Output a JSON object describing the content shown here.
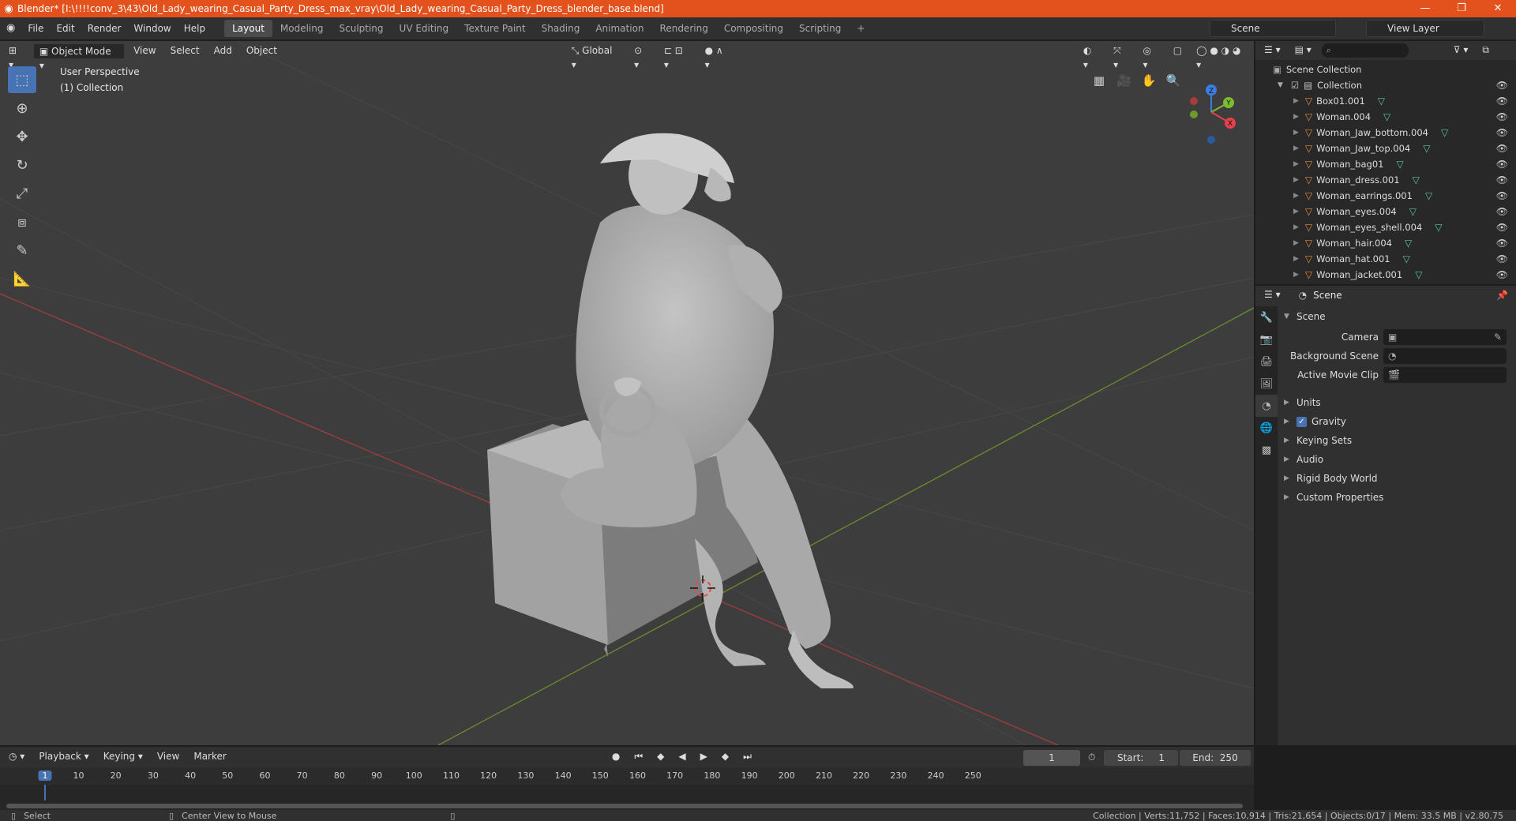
{
  "window": {
    "title": "Blender* [I:\\!!!!conv_3\\43\\Old_Lady_wearing_Casual_Party_Dress_max_vray\\Old_Lady_wearing_Casual_Party_Dress_blender_base.blend]",
    "controls": [
      "—",
      "❐",
      "✕"
    ]
  },
  "menu": [
    "File",
    "Edit",
    "Render",
    "Window",
    "Help"
  ],
  "workspaces": [
    "Layout",
    "Modeling",
    "Sculpting",
    "UV Editing",
    "Texture Paint",
    "Shading",
    "Animation",
    "Rendering",
    "Compositing",
    "Scripting"
  ],
  "workspace_add": "+",
  "active_workspace": "Layout",
  "scene_name": "Scene",
  "view_layer_name": "View Layer",
  "viewport": {
    "mode": "Object Mode",
    "menus": [
      "View",
      "Select",
      "Add",
      "Object"
    ],
    "transform_orientation": "Global",
    "info_line1": "User Perspective",
    "info_line2": "(1) Collection",
    "gizmo": {
      "z": "Z",
      "y": "Y",
      "x": "X"
    }
  },
  "outliner": {
    "root": "Scene Collection",
    "collection": "Collection",
    "objects": [
      "Box01.001",
      "Woman.004",
      "Woman_Jaw_bottom.004",
      "Woman_Jaw_top.004",
      "Woman_bag01",
      "Woman_dress.001",
      "Woman_earrings.001",
      "Woman_eyes.004",
      "Woman_eyes_shell.004",
      "Woman_hair.004",
      "Woman_hat.001",
      "Woman_jacket.001"
    ]
  },
  "properties": {
    "header": "Scene",
    "panel": "Scene",
    "fields": [
      {
        "label": "Camera",
        "value": ""
      },
      {
        "label": "Background Scene",
        "value": ""
      },
      {
        "label": "Active Movie Clip",
        "value": ""
      }
    ],
    "sections": [
      "Units",
      "Gravity",
      "Keying Sets",
      "Audio",
      "Rigid Body World",
      "Custom Properties"
    ],
    "gravity_checked": true
  },
  "timeline": {
    "menus": [
      "Playback",
      "Keying",
      "View",
      "Marker"
    ],
    "current_frame": "1",
    "start_label": "Start:",
    "start": "1",
    "end_label": "End:",
    "end": "250",
    "ticks": [
      "1",
      "10",
      "20",
      "30",
      "40",
      "50",
      "60",
      "70",
      "80",
      "90",
      "100",
      "110",
      "120",
      "130",
      "140",
      "150",
      "160",
      "170",
      "180",
      "190",
      "200",
      "210",
      "220",
      "230",
      "240",
      "250"
    ]
  },
  "statusbar": {
    "left": "Select",
    "middle": "Center View to Mouse",
    "right": "Collection | Verts:11,752 | Faces:10,914 | Tris:21,654 | Objects:0/17 | Mem: 33.5 MB | v2.80.75"
  }
}
